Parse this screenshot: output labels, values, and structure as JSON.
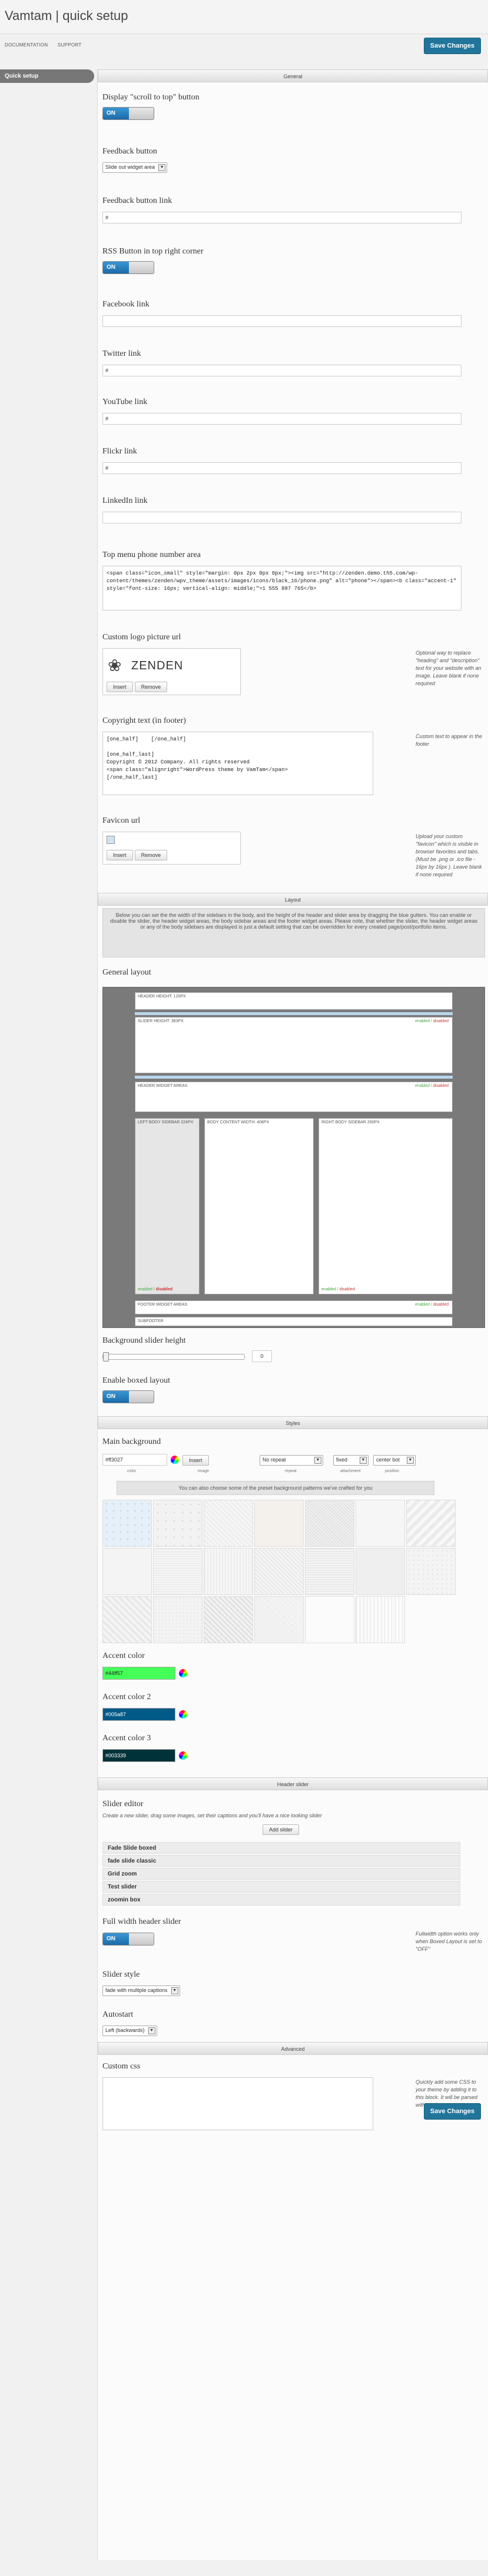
{
  "header": {
    "title": "Vamtam | quick setup",
    "save_label": "Save Changes",
    "links": [
      "DOCUMENTATION",
      "SUPPORT"
    ]
  },
  "sidebar": {
    "items": [
      {
        "label": "Quick setup"
      }
    ]
  },
  "sections": {
    "general": "General",
    "layout": "Layout",
    "styles": "Styles",
    "header_slider": "Header slider",
    "advanced": "Advanced"
  },
  "general": {
    "scroll_top_label": "Display \"scroll to top\" button",
    "toggle_on": "ON",
    "feedback_label": "Feedback button",
    "feedback_value": "Slide out widget area",
    "feedback_link_label": "Feedback button link",
    "feedback_link_value": "#",
    "rss_label": "RSS Button in top right corner",
    "facebook_label": "Facebook link",
    "facebook_value": "",
    "twitter_label": "Twitter link",
    "twitter_value": "#",
    "youtube_label": "YouTube link",
    "youtube_value": "#",
    "flickr_label": "Flickr link",
    "flickr_value": "#",
    "linkedin_label": "LinkedIn link",
    "linkedin_value": "",
    "phone_label": "Top menu phone number area",
    "phone_value": "<span class=\"icon_small\" style=\"margin: 0px 2px 0px 0px;\"><img src=\"http://zenden.demo.th5.com/wp-content/themes/zenden/wpv_theme/assets/images/icons/black_16/phone.png\" alt=\"phone\"></span><b class=\"accent-1\" style=\"font-size: 16px; vertical-align: middle;\">1 555 887 765</b>",
    "logo_label": "Custom logo picture url",
    "logo_text": "ZENDEN",
    "insert_label": "Insert",
    "remove_label": "Remove",
    "logo_hint": "Optional way to replace \"heading\" and \"description\" text for your website with an image. Leave blank if none required",
    "copyright_label": "Copyright text (in footer)",
    "copyright_value": "[one_half]    [/one_half]\n\n[one_half_last]\nCopyright © 2012 Company. All rights reserved\n<span class=\"alignright\">WordPress theme by VamTam</span>\n[/one_half_last]",
    "copyright_hint": "Custom text to appear in the footer",
    "favicon_label": "Favicon url",
    "favicon_hint": "Upload your custom \"favicon\" which is visible in browser favorites and tabs. (Must be .png or .ico file - 16px by 16px ). Leave blank if none required"
  },
  "layout": {
    "note": "Below you can set the the width of the sidebars in the body, and the height of the header and slider area by dragging the blue gutters. You can enable or disable the slider, the header widget areas, the body sidebar areas and the footer widget areas. Please note, that whether the slider, the header widget areas or any of the body sidebars are displayed is just a default setting that can be overridden for every created page/post/portfolio items.",
    "general_label": "General layout",
    "header_height": "HEADER HEIGHT: 120PX",
    "slider_height": "SLIDER HEIGHT: 383PX",
    "header_widgets": "HEADER WIDGET AREAS",
    "left_sidebar": "LEFT BODY SIDEBAR 224PX",
    "body_content": "BODY CONTENT WIDTH: 408PX",
    "right_sidebar": "RIGHT BODY SIDEBAR 260PX",
    "footer_widgets": "FOOTER WIDGET AREAS",
    "subfooter": "SUBFOOTER",
    "enabled": "enabled",
    "disabled": "disabled",
    "sep": " / ",
    "bg_slider_label": "Background slider height",
    "bg_slider_value": "0",
    "bg_slider_fill": 0,
    "boxed_label": "Enable boxed layout"
  },
  "styles": {
    "main_bg_label": "Main background",
    "bg_color": "#ff3027",
    "bg_image_btn": "Insert",
    "repeat": "No repeat",
    "attachment": "fixed",
    "position": "center bot",
    "cap_color": "color",
    "cap_image": "image",
    "cap_repeat": "repeat",
    "cap_attachment": "attachment",
    "cap_position": "position",
    "patterns_note": "You can also choose some of the preset background patterns we've crafted for you",
    "accent1_label": "Accent color",
    "accent1_value": "#44ff57",
    "accent1_color": "#44ff57",
    "accent2_label": "Accent color 2",
    "accent2_value": "#005a87",
    "accent2_color": "#005a87",
    "accent3_label": "Accent color 3",
    "accent3_value": "#003339",
    "accent3_color": "#003339"
  },
  "slider": {
    "editor_label": "Slider editor",
    "editor_desc": "Create a new slider, drag some images, set their captions and you'll have a nice looking slider",
    "add_button": "Add slider",
    "items": [
      "Fade Slide boxed",
      "fade slide classic",
      "Grid zoom",
      "Test slider",
      "zoomin box"
    ],
    "fullwidth_label": "Full width header slider",
    "fullwidth_hint": "Fullwidth option works only when Boxed Layout is set to \"OFF\"",
    "style_label": "Slider style",
    "style_value": "fade with multiple captions",
    "autostart_label": "Autostart",
    "autostart_value": "Left (backwards)"
  },
  "advanced": {
    "css_label": "Custom css",
    "css_hint": "Quickly add some CSS to your theme by adding it to this block. It will be parsed with csslint"
  }
}
